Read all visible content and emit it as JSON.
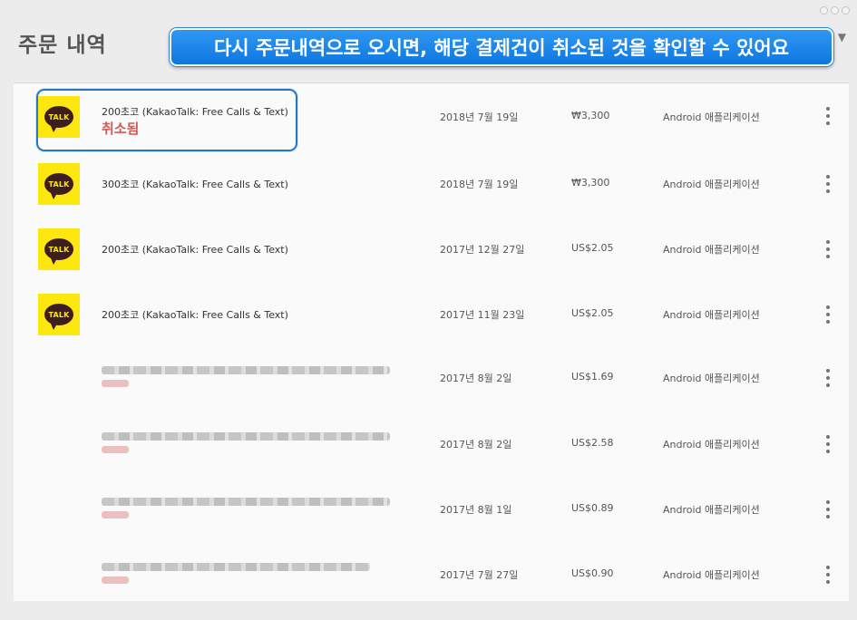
{
  "page_title": "주문 내역",
  "callout_text": "다시 주문내역으로 오시면, 해당 결제건이 취소된 것을 확인할 수 있어요",
  "app_icon_text": "TALK",
  "more_symbol": "⋮",
  "orders": [
    {
      "item": "200초코 (KakaoTalk: Free Calls & Text)",
      "status": "취소됨",
      "date": "2018년 7월 19일",
      "price": "₩3,300",
      "platform": "Android 애플리케이션",
      "icon": "kakaotalk-icon"
    },
    {
      "item": "300초코 (KakaoTalk: Free Calls & Text)",
      "date": "2018년 7월 19일",
      "price": "₩3,300",
      "platform": "Android 애플리케이션",
      "icon": "kakaotalk-icon"
    },
    {
      "item": "200초코 (KakaoTalk: Free Calls & Text)",
      "date": "2017년 12월 27일",
      "price": "US$2.05",
      "platform": "Android 애플리케이션",
      "icon": "kakaotalk-icon"
    },
    {
      "item": "200초코 (KakaoTalk: Free Calls & Text)",
      "date": "2017년 11월 23일",
      "price": "US$2.05",
      "platform": "Android 애플리케이션",
      "icon": "kakaotalk-icon"
    },
    {
      "date": "2017년 8월 2일",
      "price": "US$1.69",
      "platform": "Android 애플리케이션",
      "redacted": true
    },
    {
      "date": "2017년 8월 2일",
      "price": "US$2.58",
      "platform": "Android 애플리케이션",
      "redacted": true
    },
    {
      "date": "2017년 8월 1일",
      "price": "US$0.89",
      "platform": "Android 애플리케이션",
      "redacted": true
    },
    {
      "date": "2017년 7월 27일",
      "price": "US$0.90",
      "platform": "Android 애플리케이션",
      "redacted": true
    }
  ],
  "colors": {
    "callout": "#1a86ea",
    "highlight_border": "#2677c2",
    "status_cancelled": "#d25a52",
    "kakao_yellow": "#fde70e",
    "kakao_brown": "#3c1e1e"
  }
}
